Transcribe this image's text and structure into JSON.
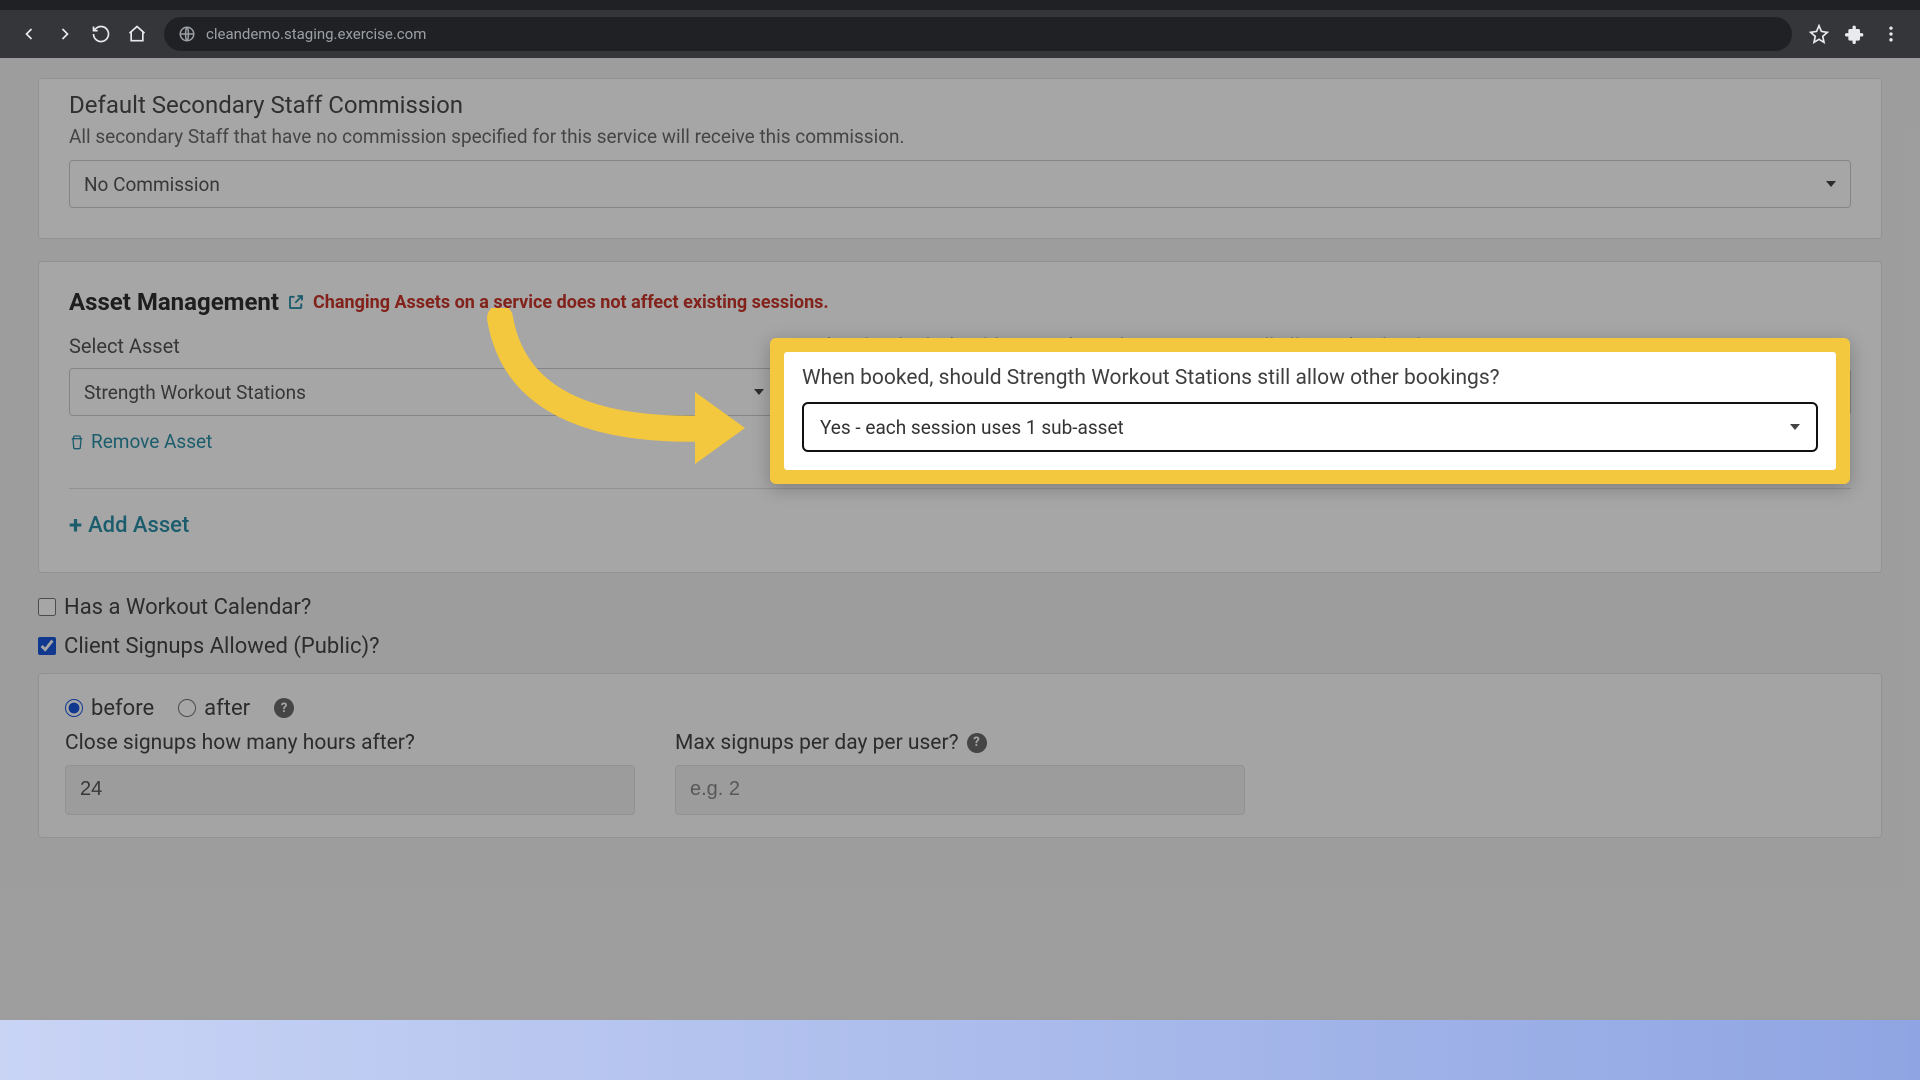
{
  "browser": {
    "url": "cleandemo.staging.exercise.com"
  },
  "commission": {
    "title": "Default Secondary Staff Commission",
    "subtitle": "All secondary Staff that have no commission specified for this service will receive this commission.",
    "select_value": "No Commission"
  },
  "asset": {
    "title": "Asset Management",
    "warning": "Changing Assets on a service does not affect existing sessions.",
    "select_label": "Select Asset",
    "select_value": "Strength Workout Stations",
    "booking_label": "When booked, should Strength Workout Stations still allow other bookings?",
    "booking_value": "Yes - each session uses 1 sub-asset",
    "remove_label": "Remove Asset",
    "add_label": "Add Asset"
  },
  "workout_calendar": {
    "label": "Has a Workout Calendar?",
    "checked": false
  },
  "client_signups": {
    "label": "Client Signups Allowed (Public)?",
    "checked": true,
    "timing": {
      "before": "before",
      "after": "after",
      "selected": "before"
    },
    "close_label": "Close signups how many hours after?",
    "close_value": "24",
    "max_label": "Max signups per day per user?",
    "max_placeholder": "e.g. 2"
  }
}
